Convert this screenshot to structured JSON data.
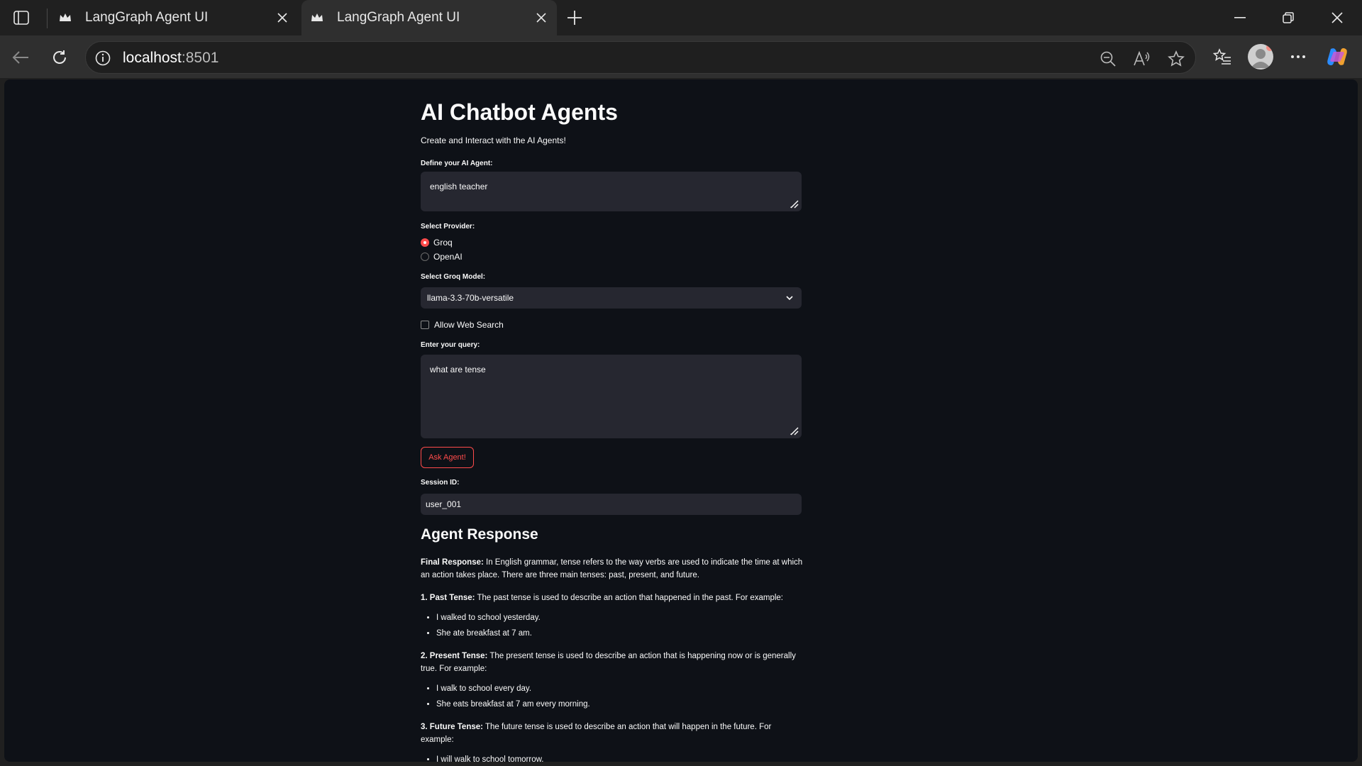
{
  "browser": {
    "tabs": [
      {
        "title": "LangGraph Agent UI"
      },
      {
        "title": "LangGraph Agent UI"
      }
    ],
    "url_host": "localhost",
    "url_port": ":8501"
  },
  "app": {
    "title": "AI Chatbot Agents",
    "subtitle": "Create and Interact with the AI Agents!",
    "agent_label": "Define your AI Agent:",
    "agent_value": "english teacher",
    "provider_label": "Select Provider:",
    "providers": [
      "Groq",
      "OpenAI"
    ],
    "selected_provider": "Groq",
    "model_label": "Select Groq Model:",
    "model_value": "llama-3.3-70b-versatile",
    "web_search_label": "Allow Web Search",
    "web_search_checked": false,
    "query_label": "Enter your query:",
    "query_value": "what are tense",
    "ask_button": "Ask Agent!",
    "session_label": "Session ID:",
    "session_value": "user_001",
    "accent_color": "#ff4b4b"
  },
  "response": {
    "title": "Agent Response",
    "intro_bold": "Final Response:",
    "intro_text": " In English grammar, tense refers to the way verbs are used to indicate the time at which an action takes place. There are three main tenses: past, present, and future.",
    "sections": [
      {
        "heading": "1. Past Tense:",
        "text": " The past tense is used to describe an action that happened in the past. For example:",
        "examples": [
          "I walked to school yesterday.",
          "She ate breakfast at 7 am."
        ]
      },
      {
        "heading": "2. Present Tense:",
        "text": " The present tense is used to describe an action that is happening now or is generally true. For example:",
        "examples": [
          "I walk to school every day.",
          "She eats breakfast at 7 am every morning."
        ]
      },
      {
        "heading": "3. Future Tense:",
        "text": " The future tense is used to describe an action that will happen in the future. For example:",
        "examples": [
          "I will walk to school tomorrow."
        ]
      }
    ]
  }
}
